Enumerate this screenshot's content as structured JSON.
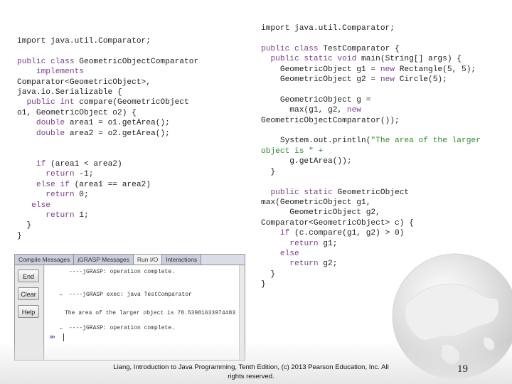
{
  "slide": {
    "left_code": [
      [
        {
          "t": "import java.util.Comparator;"
        }
      ],
      [
        {
          "t": ""
        }
      ],
      [
        {
          "t": "public class",
          "c": "kw"
        },
        {
          "t": " GeometricObjectComparator"
        }
      ],
      [
        {
          "t": "    implements",
          "c": "kw"
        }
      ],
      [
        {
          "t": "Comparator<GeometricObject>,"
        }
      ],
      [
        {
          "t": "java.io.Serializable {"
        }
      ],
      [
        {
          "t": "  "
        },
        {
          "t": "public int",
          "c": "kw"
        },
        {
          "t": " compare(GeometricObject"
        }
      ],
      [
        {
          "t": "o1, GeometricObject o2) {"
        }
      ],
      [
        {
          "t": "    "
        },
        {
          "t": "double",
          "c": "kw"
        },
        {
          "t": " area1 = o1.getArea();"
        }
      ],
      [
        {
          "t": "    "
        },
        {
          "t": "double",
          "c": "kw"
        },
        {
          "t": " area2 = o2.getArea();"
        }
      ],
      [
        {
          "t": ""
        }
      ],
      [
        {
          "t": ""
        }
      ],
      [
        {
          "t": "    "
        },
        {
          "t": "if",
          "c": "kw"
        },
        {
          "t": " (area1 < area2)"
        }
      ],
      [
        {
          "t": "      "
        },
        {
          "t": "return",
          "c": "kw"
        },
        {
          "t": " -1;"
        }
      ],
      [
        {
          "t": "    "
        },
        {
          "t": "else if",
          "c": "kw"
        },
        {
          "t": " (area1 == area2)"
        }
      ],
      [
        {
          "t": "      "
        },
        {
          "t": "return",
          "c": "kw"
        },
        {
          "t": " 0;"
        }
      ],
      [
        {
          "t": "   "
        },
        {
          "t": "else",
          "c": "kw"
        }
      ],
      [
        {
          "t": "      "
        },
        {
          "t": "return",
          "c": "kw"
        },
        {
          "t": " 1;"
        }
      ],
      [
        {
          "t": "  }"
        }
      ],
      [
        {
          "t": "}"
        }
      ]
    ],
    "right_code": [
      [
        {
          "t": "import java.util.Comparator;"
        }
      ],
      [
        {
          "t": ""
        }
      ],
      [
        {
          "t": "public class",
          "c": "kw"
        },
        {
          "t": " TestComparator {"
        }
      ],
      [
        {
          "t": "  "
        },
        {
          "t": "public static void",
          "c": "kw"
        },
        {
          "t": " main(String[] args) {"
        }
      ],
      [
        {
          "t": "    GeometricObject g1 = "
        },
        {
          "t": "new",
          "c": "kw"
        },
        {
          "t": " Rectangle(5, 5);"
        }
      ],
      [
        {
          "t": "    GeometricObject g2 = "
        },
        {
          "t": "new",
          "c": "kw"
        },
        {
          "t": " Circle(5);"
        }
      ],
      [
        {
          "t": ""
        }
      ],
      [
        {
          "t": "    GeometricObject g ="
        }
      ],
      [
        {
          "t": "      max(g1, g2, "
        },
        {
          "t": "new",
          "c": "kw"
        }
      ],
      [
        {
          "t": "GeometricObjectComparator());"
        }
      ],
      [
        {
          "t": ""
        }
      ],
      [
        {
          "t": "    System.out.println("
        },
        {
          "t": "\"The area of the larger",
          "c": "str"
        }
      ],
      [
        {
          "t": "object is \" +",
          "c": "str"
        }
      ],
      [
        {
          "t": "      g.getArea());"
        }
      ],
      [
        {
          "t": "  }"
        }
      ],
      [
        {
          "t": ""
        }
      ],
      [
        {
          "t": "  "
        },
        {
          "t": "public static",
          "c": "kw"
        },
        {
          "t": " GeometricObject"
        }
      ],
      [
        {
          "t": "max(GeometricObject g1,"
        }
      ],
      [
        {
          "t": "      GeometricObject g2,"
        }
      ],
      [
        {
          "t": "Comparator<GeometricObject> c) {"
        }
      ],
      [
        {
          "t": "    "
        },
        {
          "t": "if",
          "c": "kw"
        },
        {
          "t": " (c.compare(g1, g2) > 0)"
        }
      ],
      [
        {
          "t": "      "
        },
        {
          "t": "return",
          "c": "kw"
        },
        {
          "t": " g1;"
        }
      ],
      [
        {
          "t": "    "
        },
        {
          "t": "else",
          "c": "kw"
        }
      ],
      [
        {
          "t": "      "
        },
        {
          "t": "return",
          "c": "kw"
        },
        {
          "t": " g2;"
        }
      ],
      [
        {
          "t": "  }"
        }
      ],
      [
        {
          "t": "}"
        }
      ]
    ],
    "footer_line1": "Liang, Introduction to Java Programming, Tenth Edition, (c) 2013 Pearson Education, Inc. All",
    "footer_line2": "rights reserved.",
    "page_number": "19"
  },
  "console": {
    "tabs": [
      "Compile Messages",
      "jGRASP Messages",
      "Run I/O",
      "Interactions"
    ],
    "active_tab_index": 2,
    "buttons": {
      "end": "End",
      "clear": "Clear",
      "help": "Help"
    },
    "lines": [
      "----jGRASP: operation complete.",
      "----jGRASP exec: java TestComparator",
      "The area of the larger object is 78.53981633974483",
      "----jGRASP: operation complete."
    ],
    "prompt_glyph": "»»"
  },
  "colors": {
    "keyword": "#7a3e8e",
    "string": "#2e8b2e",
    "text": "#222222",
    "prompt": "#2a3fa8"
  }
}
